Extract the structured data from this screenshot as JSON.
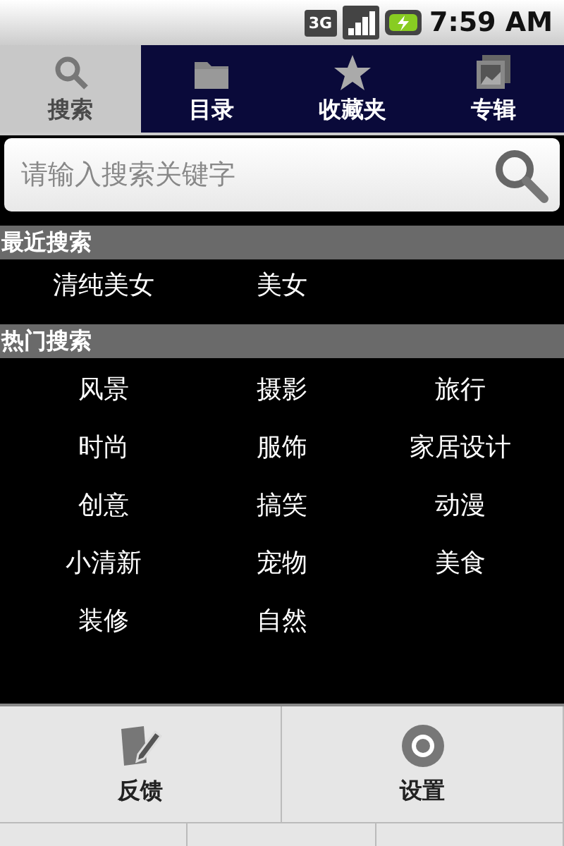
{
  "status_bar": {
    "network": "3G",
    "time": "7:59 AM"
  },
  "tabs": [
    {
      "label": "搜索",
      "kind": "search",
      "selected": true
    },
    {
      "label": "目录",
      "kind": "folder",
      "selected": false
    },
    {
      "label": "收藏夹",
      "kind": "star",
      "selected": false
    },
    {
      "label": "专辑",
      "kind": "album",
      "selected": false
    }
  ],
  "search": {
    "placeholder": "请输入搜索关键字"
  },
  "recent": {
    "title": "最近搜索",
    "items": [
      "清纯美女",
      "美女"
    ]
  },
  "hot": {
    "title": "热门搜索",
    "items": [
      "风景",
      "摄影",
      "旅行",
      "时尚",
      "服饰",
      "家居设计",
      "创意",
      "搞笑",
      "动漫",
      "小清新",
      "宠物",
      "美食",
      "装修",
      "自然"
    ]
  },
  "menu": [
    {
      "label": "反馈",
      "kind": "feedback"
    },
    {
      "label": "设置",
      "kind": "settings"
    }
  ]
}
